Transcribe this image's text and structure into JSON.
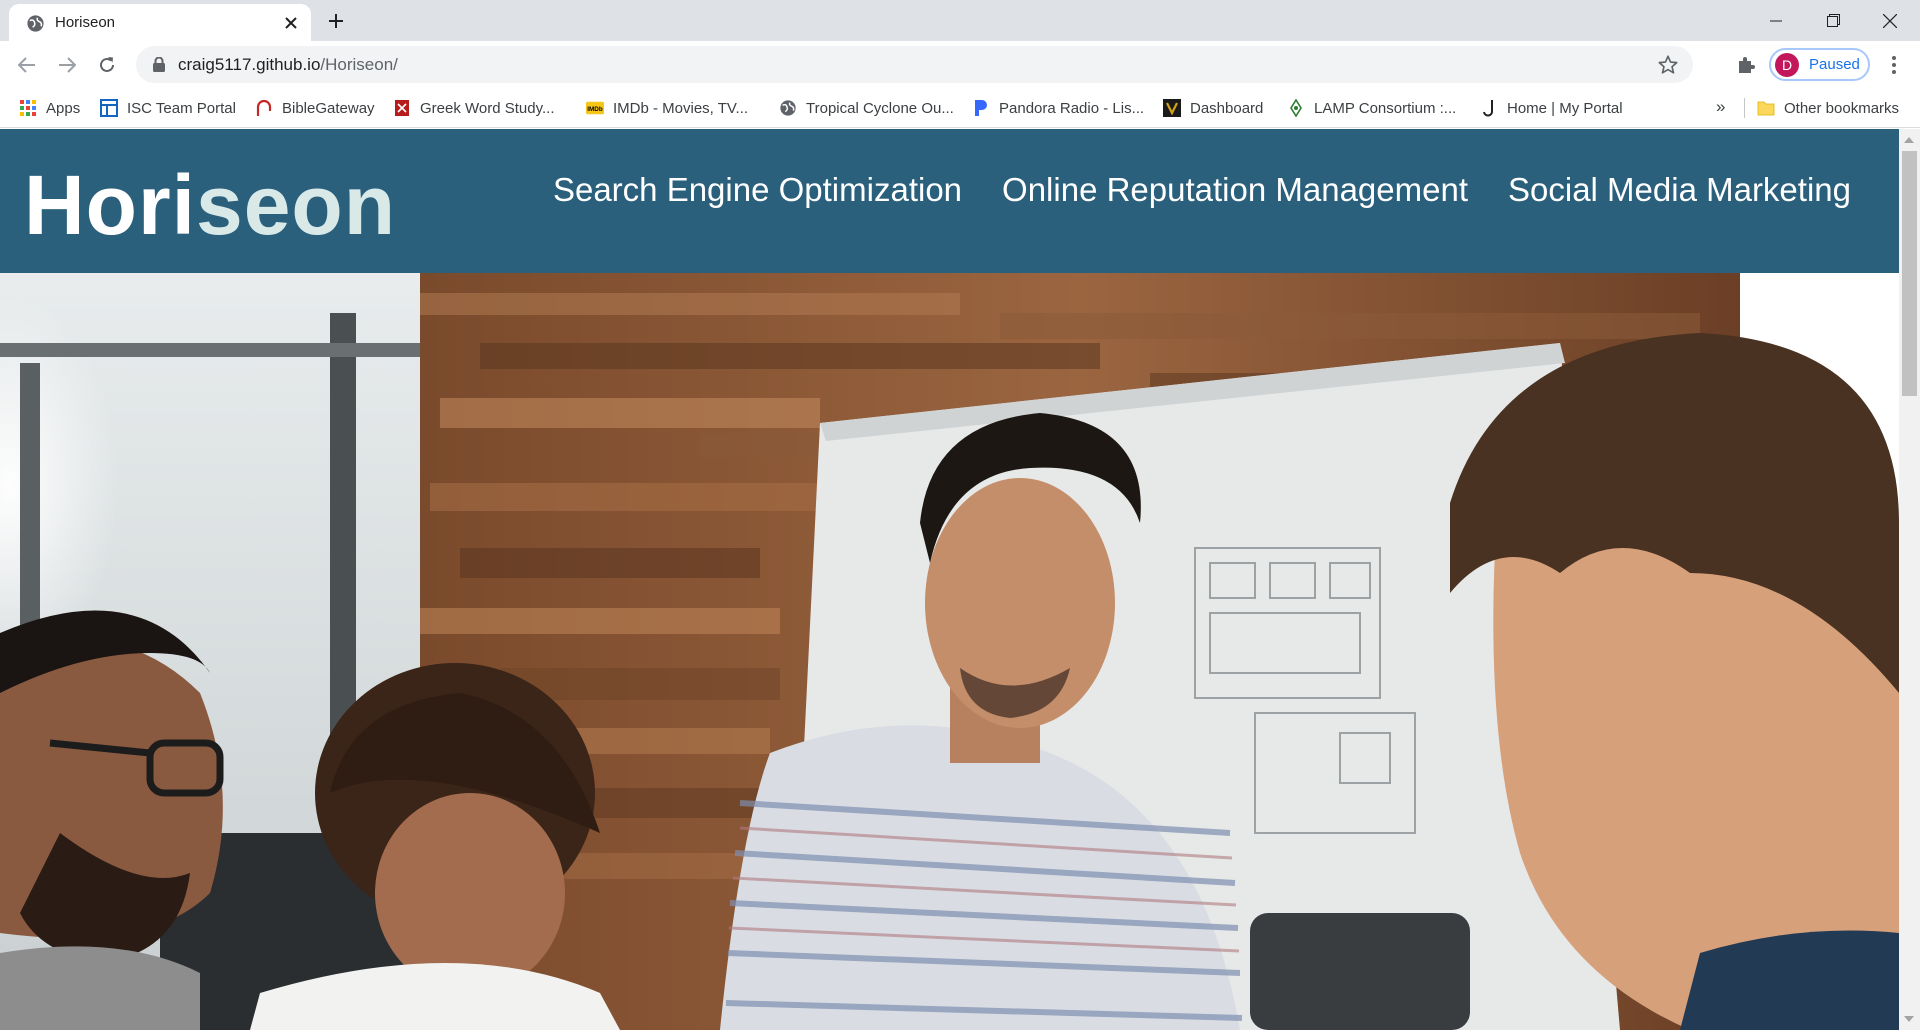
{
  "browser": {
    "tab": {
      "title": "Horiseon",
      "favicon": "globe-icon",
      "close_icon": "close-icon"
    },
    "new_tab_icon": "plus-icon",
    "window_controls": [
      "minimize-icon",
      "restore-icon",
      "close-icon"
    ],
    "toolbar": {
      "back_icon": "back-arrow-icon",
      "forward_icon": "forward-arrow-icon",
      "reload_icon": "reload-icon",
      "url_host": "craig5117.github.io",
      "url_path": "/Horiseon/",
      "bookmark_star_icon": "star-icon",
      "extensions_icon": "puzzle-icon",
      "profile": {
        "initial": "D",
        "label": "Paused",
        "color": "#c2185b"
      },
      "menu_icon": "kebab-menu-icon"
    },
    "bookmarks": [
      {
        "label": "Apps",
        "icon": "apps-grid-icon"
      },
      {
        "label": "ISC Team Portal",
        "icon": "portal-icon"
      },
      {
        "label": "BibleGateway",
        "icon": "biblegateway-icon"
      },
      {
        "label": "Greek Word Study...",
        "icon": "book-icon"
      },
      {
        "label": "IMDb - Movies, TV...",
        "icon": "imdb-icon"
      },
      {
        "label": "Tropical Cyclone Ou...",
        "icon": "globe-icon"
      },
      {
        "label": "Pandora Radio - Lis...",
        "icon": "pandora-icon"
      },
      {
        "label": "Dashboard",
        "icon": "shield-logo-icon"
      },
      {
        "label": "LAMP Consortium :...",
        "icon": "lamp-icon"
      },
      {
        "label": "Home | My Portal",
        "icon": "j-logo-icon"
      }
    ],
    "bookmarks_overflow": "»",
    "other_bookmarks": "Other bookmarks"
  },
  "site": {
    "logo_prefix": "Hori",
    "logo_suffix": "seon",
    "nav": [
      {
        "label": "Search Engine Optimization"
      },
      {
        "label": "Online Reputation Management"
      },
      {
        "label": "Social Media Marketing"
      }
    ],
    "colors": {
      "header_bg": "#2a607c",
      "logo_accent": "#d9e9e8"
    },
    "hero": {
      "description": "photo of four people collaborating around a table in an office with a wood-panel wall and whiteboard"
    }
  }
}
